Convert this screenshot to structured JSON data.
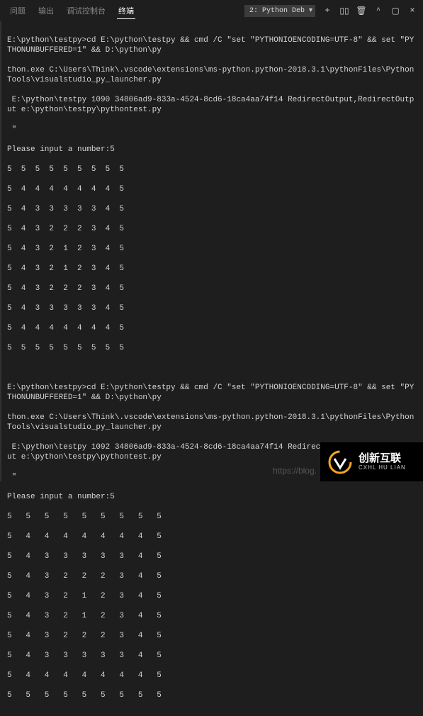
{
  "tabs": {
    "problems": "问题",
    "output": "输出",
    "debugconsole": "调试控制台",
    "terminal": "终端"
  },
  "picker_label": "2: Python Deb",
  "icons": {
    "plus": "+",
    "split": "▯▯",
    "trash": "🗑",
    "maximize": "▢",
    "close": "×"
  },
  "run1": {
    "prefix": "E:\\python\\testpy>",
    "cmd1": "cd E:\\python\\testpy && cmd /C \"set \"PYTHONIOENCODING=UTF-8\" && set \"PYTHONUNBUFFERED=1\" && D:\\python\\py",
    "cmd2": "thon.exe C:\\Users\\Think\\.vscode\\extensions\\ms-python.python-2018.3.1\\pythonFiles\\PythonTools\\visualstudio_py_launcher.py",
    "cmd3": " E:\\python\\testpy 1090 34806ad9-833a-4524-8cd6-18ca4aa74f14 RedirectOutput,RedirectOutput e:\\python\\testpy\\pythontest.py",
    "cmd4": " \""
  },
  "prompt1": "Please input a number:5",
  "grid1": [
    "5  5  5  5  5  5  5  5  5",
    "",
    "5  4  4  4  4  4  4  4  5",
    "",
    "5  4  3  3  3  3  3  4  5",
    "",
    "5  4  3  2  2  2  3  4  5",
    "",
    "5  4  3  2  1  2  3  4  5",
    "",
    "5  4  3  2  1  2  3  4  5",
    "",
    "5  4  3  2  2  2  3  4  5",
    "",
    "5  4  3  3  3  3  3  4  5",
    "",
    "5  4  4  4  4  4  4  4  5",
    "",
    "5  5  5  5  5  5  5  5  5"
  ],
  "run2": {
    "prefix": "E:\\python\\testpy>",
    "cmd1": "cd E:\\python\\testpy && cmd /C \"set \"PYTHONIOENCODING=UTF-8\" && set \"PYTHONUNBUFFERED=1\" && D:\\python\\py",
    "cmd2": "thon.exe C:\\Users\\Think\\.vscode\\extensions\\ms-python.python-2018.3.1\\pythonFiles\\PythonTools\\visualstudio_py_launcher.py",
    "cmd3": " E:\\python\\testpy 1092 34806ad9-833a-4524-8cd6-18ca4aa74f14 RedirectOutput,RedirectOutput e:\\python\\testpy\\pythontest.py",
    "cmd4": " \""
  },
  "prompt2": "Please input a number:5",
  "grid2": [
    "5   5   5   5   5   5   5   5   5",
    "",
    "5   4   4   4   4   4   4   4   5",
    "",
    "5   4   3   3   3   3   3   4   5",
    "",
    "5   4   3   2   2   2   3   4   5",
    "",
    "5   4   3   2   1   2   3   4   5",
    "",
    "5   4   3   2   1   2   3   4   5",
    "",
    "5   4   3   2   2   2   3   4   5",
    "",
    "5   4   3   3   3   3   3   4   5",
    "",
    "5   4   4   4   4   4   4   4   5",
    "",
    "5   5   5   5   5   5   5   5   5"
  ],
  "watermark": "https://blog.",
  "brand": {
    "title": "创新互联",
    "sub": "CXHL HU LIAN"
  }
}
